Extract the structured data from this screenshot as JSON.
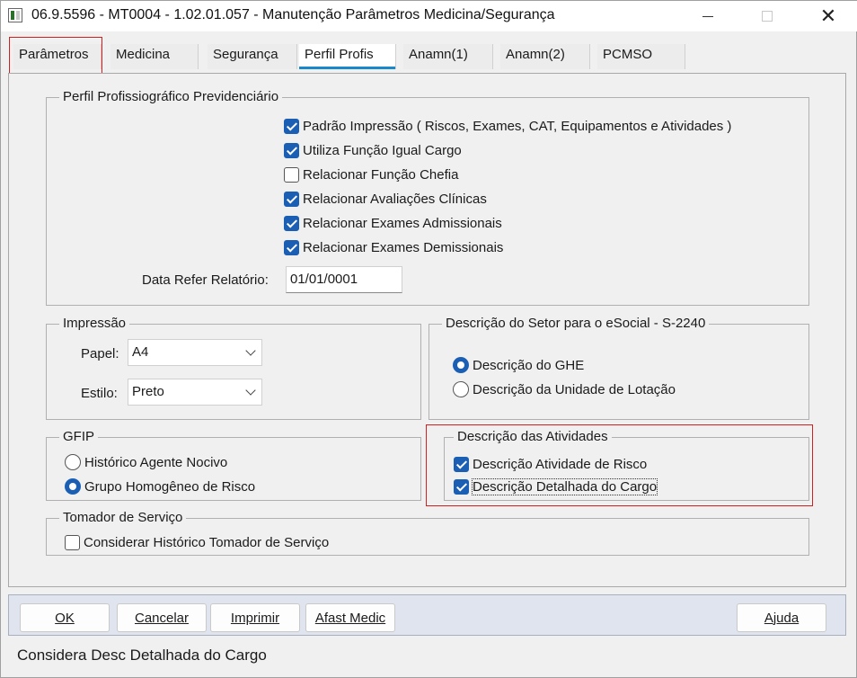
{
  "window": {
    "title": "06.9.5596 - MT0004 - 1.02.01.057 - Manutenção Parâmetros Medicina/Segurança",
    "close_symbol": "✕"
  },
  "tabs": [
    {
      "label": "Parâmetros"
    },
    {
      "label": "Medicina"
    },
    {
      "label": "Segurança"
    },
    {
      "label": "Perfil Profis",
      "active": true
    },
    {
      "label": "Anamn(1)"
    },
    {
      "label": "Anamn(2)"
    },
    {
      "label": "PCMSO"
    }
  ],
  "ppp": {
    "title": "Perfil Profissiográfico Previdenciário",
    "options": [
      {
        "label": "Padrão Impressão ( Riscos, Exames, CAT, Equipamentos e Atividades )",
        "checked": true
      },
      {
        "label": "Utiliza Função Igual Cargo",
        "checked": true
      },
      {
        "label": "Relacionar Função Chefia",
        "checked": false
      },
      {
        "label": "Relacionar Avaliações Clínicas",
        "checked": true
      },
      {
        "label": "Relacionar Exames Admissionais",
        "checked": true
      },
      {
        "label": "Relacionar Exames Demissionais",
        "checked": true
      }
    ],
    "date_label": "Data Refer Relatório:",
    "date_value": "01/01/0001"
  },
  "impressao": {
    "title": "Impressão",
    "papel_label": "Papel:",
    "papel_value": "A4",
    "estilo_label": "Estilo:",
    "estilo_value": "Preto"
  },
  "setor": {
    "title": "Descrição do Setor para o eSocial - S-2240",
    "options": [
      {
        "label": "Descrição do GHE",
        "selected": true
      },
      {
        "label": "Descrição da Unidade de Lotação",
        "selected": false
      }
    ]
  },
  "gfip": {
    "title": "GFIP",
    "options": [
      {
        "label": "Histórico Agente Nocivo",
        "selected": false
      },
      {
        "label": "Grupo Homogêneo de Risco",
        "selected": true
      }
    ]
  },
  "atividades": {
    "title": "Descrição das Atividades",
    "options": [
      {
        "label": "Descrição Atividade de Risco",
        "checked": true
      },
      {
        "label": "Descrição Detalhada do Cargo",
        "checked": true
      }
    ]
  },
  "tomador": {
    "title": "Tomador de Serviço",
    "option": {
      "label": "Considerar Histórico Tomador de Serviço",
      "checked": false
    }
  },
  "buttons": {
    "ok": "OK",
    "cancelar": "Cancelar",
    "imprimir": "Imprimir",
    "afast": "Afast Medic",
    "ajuda": "Ajuda"
  },
  "status": "Considera Desc Detalhada do Cargo",
  "colors": {
    "accent": "#1a5fb4",
    "tab_underline": "#1a88c9",
    "highlight_border": "#d02020"
  }
}
